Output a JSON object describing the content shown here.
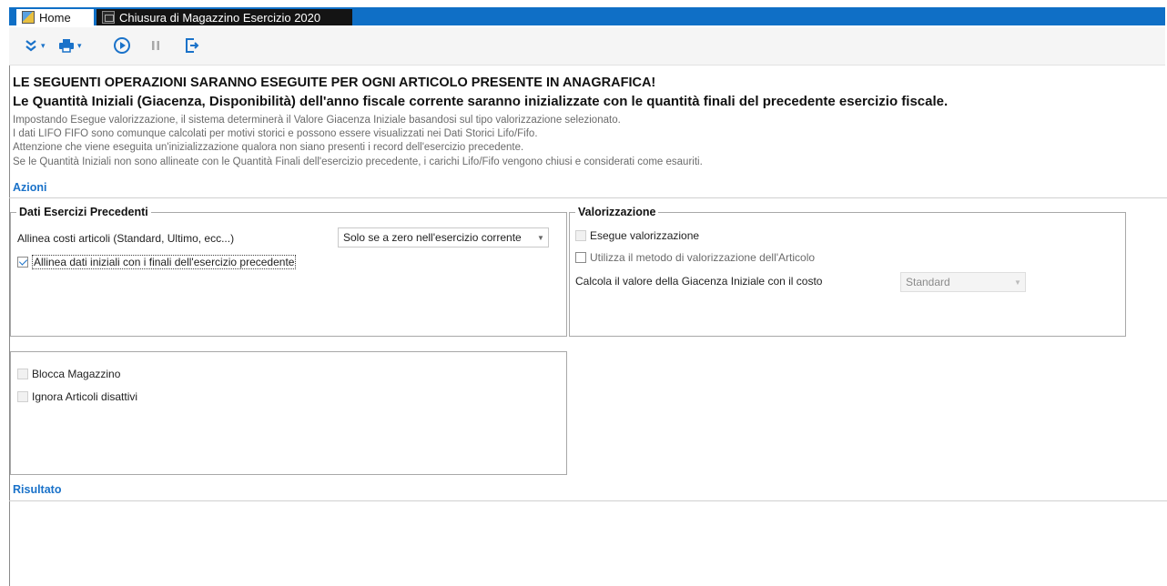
{
  "tabs": [
    {
      "label": "Home",
      "icon": "home-icon"
    },
    {
      "label": "Chiusura di Magazzino Esercizio 2020",
      "icon": "document-icon"
    }
  ],
  "toolbar": {
    "items": [
      "expand-chevrons-icon",
      "print-icon",
      "play-icon",
      "pause-icon",
      "exit-icon"
    ]
  },
  "notice": {
    "headline": "LE SEGUENTI OPERAZIONI SARANNO ESEGUITE PER OGNI ARTICOLO PRESENTE IN ANAGRAFICA!",
    "subhead": "Le Quantità Iniziali (Giacenza, Disponibilità) dell'anno fiscale corrente saranno inizializzate con le quantità finali del precedente esercizio fiscale.",
    "lines": [
      "Impostando Esegue valorizzazione, il sistema determinerà il Valore Giacenza Iniziale basandosi sul tipo valorizzazione selezionato.",
      "I dati LIFO FIFO sono comunque calcolati per motivi storici e possono essere visualizzati nei Dati Storici Lifo/Fifo.",
      "Attenzione che viene eseguita un'inizializzazione qualora non siano presenti i record dell'esercizio precedente.",
      "Se le Quantità Iniziali non sono allineate con le Quantità Finali dell'esercizio precedente, i carichi Lifo/Fifo vengono chiusi e considerati come esauriti."
    ]
  },
  "sections": {
    "azioni": "Azioni",
    "risultato": "Risultato"
  },
  "dati_esercizi": {
    "title": "Dati Esercizi Precedenti",
    "allinea_costi_label": "Allinea costi articoli (Standard, Ultimo, ecc...)",
    "allinea_costi_value": "Solo se a zero nell'esercizio corrente",
    "allinea_dati_label": "Allinea dati iniziali con i finali dell'esercizio precedente"
  },
  "valorizzazione": {
    "title": "Valorizzazione",
    "esegue_label": "Esegue valorizzazione",
    "utilizza_label": "Utilizza il metodo di valorizzazione dell'Articolo",
    "calcola_label": "Calcola il valore della Giacenza Iniziale con il costo",
    "calcola_value": "Standard"
  },
  "options": {
    "blocca_label": "Blocca Magazzino",
    "ignora_label": "Ignora Articoli disattivi"
  },
  "colors": {
    "accent": "#1a72c9",
    "tabbar": "#0f6fc6",
    "active_tab": "#141414"
  }
}
